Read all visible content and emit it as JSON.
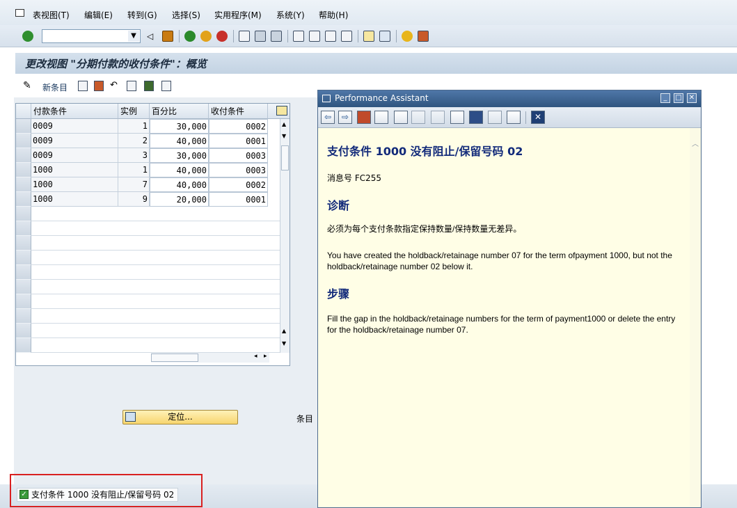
{
  "menubar": {
    "items": [
      "表视图(T)",
      "编辑(E)",
      "转到(G)",
      "选择(S)",
      "实用程序(M)",
      "系统(Y)",
      "帮助(H)"
    ]
  },
  "toolbar": {
    "command_field": ""
  },
  "screen": {
    "title": "更改视图 \"分期付款的收付条件\"：概览"
  },
  "app_toolbar": {
    "new_entries_label": "新条目"
  },
  "table": {
    "headers": [
      "付款条件",
      "实例",
      "百分比",
      "收付条件"
    ],
    "rows": [
      [
        "0009",
        "1",
        "30,000",
        "0002"
      ],
      [
        "0009",
        "2",
        "40,000",
        "0001"
      ],
      [
        "0009",
        "3",
        "30,000",
        "0003"
      ],
      [
        "1000",
        "1",
        "40,000",
        "0003"
      ],
      [
        "1000",
        "7",
        "40,000",
        "0002"
      ],
      [
        "1000",
        "9",
        "20,000",
        "0001"
      ]
    ]
  },
  "position_button": {
    "label": "定位..."
  },
  "entry_label": "条目",
  "status": {
    "message": "支付条件 1000 没有阻止/保留号码 02",
    "type_icon": "success-check-icon"
  },
  "performance_assistant": {
    "window_title": "Performance Assistant",
    "heading": "支付条件 1000 没有阻止/保留号码 02",
    "message_number": "消息号 FC255",
    "diagnosis_heading": "诊断",
    "diagnosis_text_cn": "必须为每个支付条款指定保持数量/保持数量无差异。",
    "diagnosis_text_en": "You have created the holdback/retainage number 07 for the term ofpayment 1000, but not the holdback/retainage number 02 below it.",
    "procedure_heading": "步骤",
    "procedure_text": "Fill the gap in the holdback/retainage numbers for the term of payment1000 or delete the entry for the holdback/retainage number 07."
  },
  "colors": {
    "title_text": "#1b2b3e",
    "pa_heading": "#122a7a",
    "pa_background": "#fffee6",
    "highlight": "#d92020",
    "button_yellow": "#f7d56e"
  }
}
